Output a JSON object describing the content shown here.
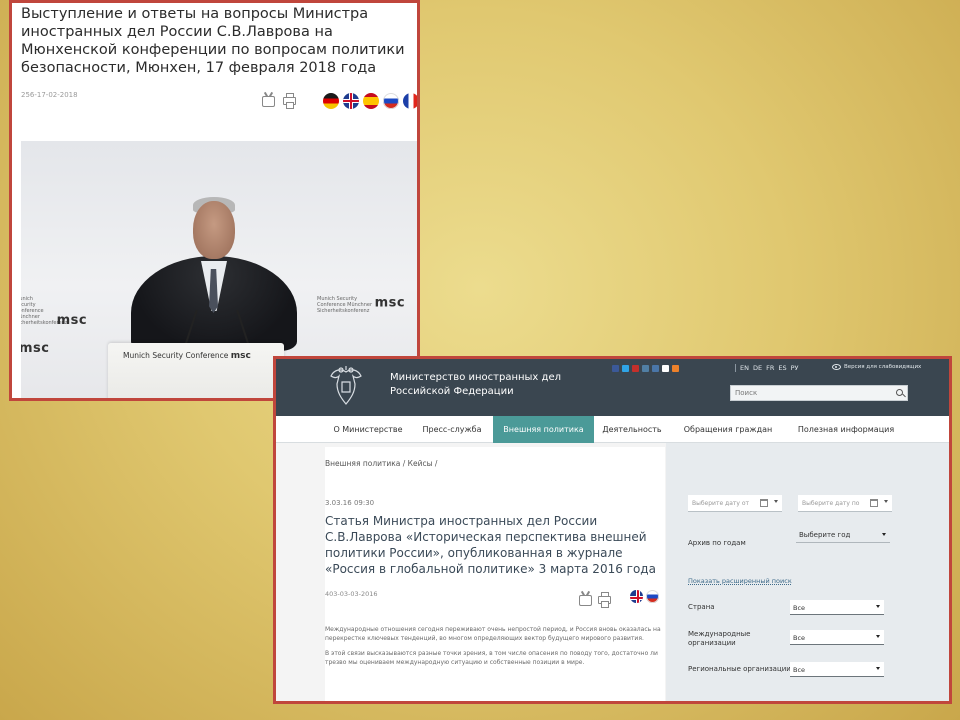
{
  "article1": {
    "title": "Выступление и ответы на вопросы Министра иностранных дел России С.В.Лаврова на Мюнхенской конференции по вопросам политики безопасности, Мюнхен, 17 февраля 2018 года",
    "date": "256-17-02-2018",
    "podium_label": "Munich Security Conference",
    "podium_logo": "msc",
    "backdrop_logo_text": "Munich Security Conference Münchner Sicherheitskonferenz",
    "backdrop_logo": "msc"
  },
  "site": {
    "ministry_line1": "Министерство иностранных дел",
    "ministry_line2": "Российской Федерации",
    "languages": [
      "EN",
      "DE",
      "FR",
      "ES",
      "РУ"
    ],
    "vision_link": "Версия для слабовидящих",
    "search_placeholder": "Поиск",
    "social_colors": [
      "#3b5998",
      "#2fa4e7",
      "#c4302b",
      "#517fa4",
      "#4a76a8",
      "#ffffff",
      "#ed812b"
    ]
  },
  "nav": {
    "items": [
      "О Министерстве",
      "Пресс-служба",
      "Внешняя политика",
      "Деятельность",
      "Обращения граждан",
      "Полезная информация"
    ],
    "active_index": 2
  },
  "article2": {
    "breadcrumb": "Внешняя политика / Кейсы /",
    "date_time": "3.03.16 09:30",
    "title": "Статья Министра иностранных дел России С.В.Лаврова «Историческая перспектива внешней политики России», опубликованная в журнале «Россия в глобальной политике» 3 марта 2016 года",
    "date": "403-03-03-2016",
    "body": [
      "Международные отношения сегодня переживают очень непростой период, и Россия вновь оказалась на перекрестке ключевых тенденций, во многом определяющих вектор будущего мирового развития.",
      "В этой связи высказываются разные точки зрения, в том числе опасения по поводу того, достаточно ли трезво мы оцениваем международную ситуацию и собственные позиции в мире."
    ]
  },
  "sidebar": {
    "date_from": "Выберите дату от",
    "date_to": "Выберите дату по",
    "archive_label": "Архив по годам",
    "year_select": "Выберите год",
    "advanced_link": "Показать расширенный поиск",
    "country_label": "Страна",
    "country_value": "Все",
    "intl_org_label": "Международные организации",
    "intl_org_value": "Все",
    "regional_label": "Региональные организации",
    "regional_value": "Все"
  }
}
